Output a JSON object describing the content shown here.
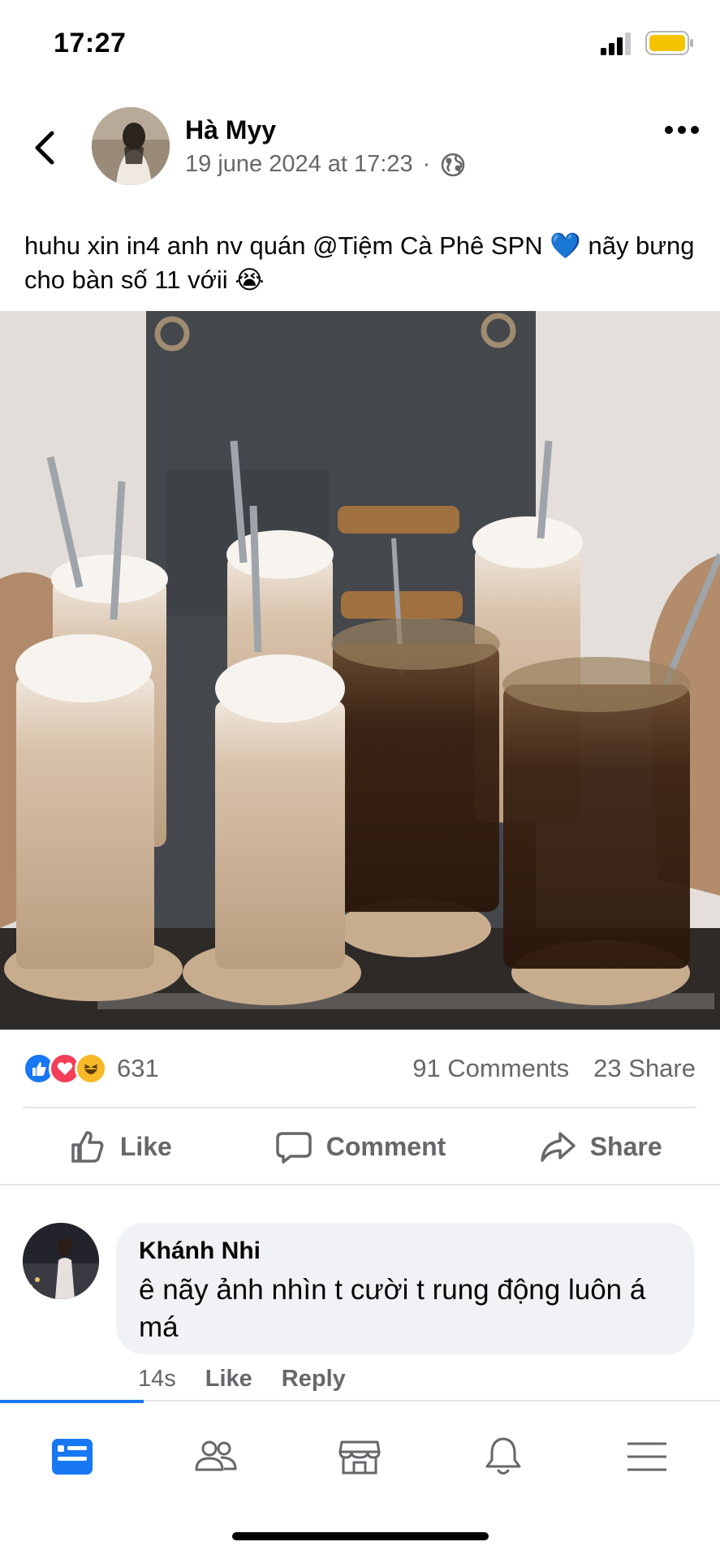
{
  "status_bar": {
    "time": "17:27",
    "signal_icon": "signal-bars-icon",
    "battery_icon": "battery-icon",
    "battery_color": "#f5c400"
  },
  "post": {
    "author": "Hà Myy",
    "timestamp": "19 june 2024 at 17:23",
    "separator": "·",
    "privacy_icon": "globe-icon",
    "text": "huhu xin in4 anh nv quán @Tiệm Cà Phê SPN 💙 nãy bưng cho bàn số 11 vớii 😭",
    "reaction_count": "631",
    "comments_count": "91 Comments",
    "share_count": "23 Share",
    "reactions": [
      "like-reaction-icon",
      "love-reaction-icon",
      "haha-reaction-icon"
    ]
  },
  "actions": {
    "like": "Like",
    "comment": "Comment",
    "share": "Share"
  },
  "comment": {
    "name": "Khánh Nhi",
    "text": "ê nãy ảnh nhìn t cười t rung động luôn á má",
    "time": "14s",
    "like": "Like",
    "reply": "Reply"
  },
  "tabbar": {
    "active": "feed",
    "accent": "#1877f2",
    "tabs": [
      "feed-icon",
      "friends-icon",
      "marketplace-icon",
      "notifications-icon",
      "menu-icon"
    ]
  }
}
